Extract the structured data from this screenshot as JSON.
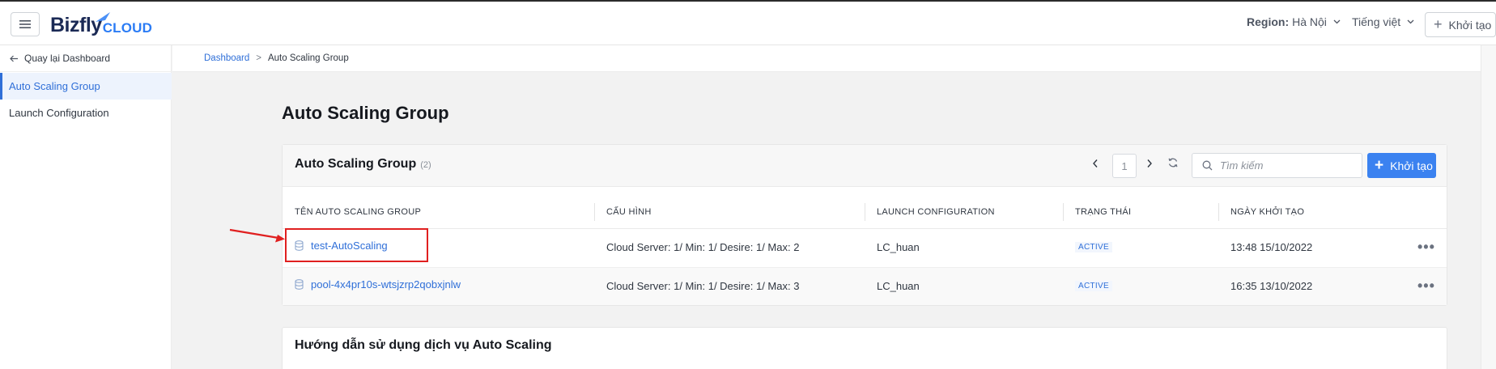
{
  "header": {
    "logo": {
      "bizfly": "Bizfly",
      "cloud": "CLOUD"
    },
    "region_label": "Region:",
    "region_value": "Hà Nội",
    "language": "Tiếng việt",
    "create_label": "Khởi tạo"
  },
  "sidebar": {
    "back_label": "Quay lại Dashboard",
    "items": [
      {
        "label": "Auto Scaling Group",
        "active": true
      },
      {
        "label": "Launch Configuration",
        "active": false
      }
    ]
  },
  "breadcrumb": {
    "dashboard": "Dashboard",
    "separator": ">",
    "current": "Auto Scaling Group"
  },
  "page_title": "Auto Scaling Group",
  "group_card": {
    "title": "Auto Scaling Group",
    "count": "(2)",
    "page_number": "1",
    "search_placeholder": "Tìm kiếm",
    "create_label": "Khởi tạo",
    "columns": [
      "TÊN AUTO SCALING GROUP",
      "CẤU HÌNH",
      "LAUNCH CONFIGURATION",
      "TRẠNG THÁI",
      "NGÀY KHỞI TẠO"
    ],
    "rows": [
      {
        "name": "test-AutoScaling",
        "config": "Cloud Server: 1/ Min: 1/ Desire: 1/ Max: 2",
        "launch_config": "LC_huan",
        "status": "ACTIVE",
        "created": "13:48 15/10/2022",
        "more": "•••"
      },
      {
        "name": "pool-4x4pr10s-wtsjzrp2qobxjnlw",
        "config": "Cloud Server: 1/ Min: 1/ Desire: 1/ Max: 3",
        "launch_config": "LC_huan",
        "status": "ACTIVE",
        "created": "16:35 13/10/2022",
        "more": "•••"
      }
    ]
  },
  "guide_card": {
    "title": "Hướng dẫn sử dụng dịch vụ Auto Scaling"
  },
  "colors": {
    "accent": "#2f6fd8",
    "primary_button": "#3b82f0",
    "annotation": "#e02020"
  }
}
